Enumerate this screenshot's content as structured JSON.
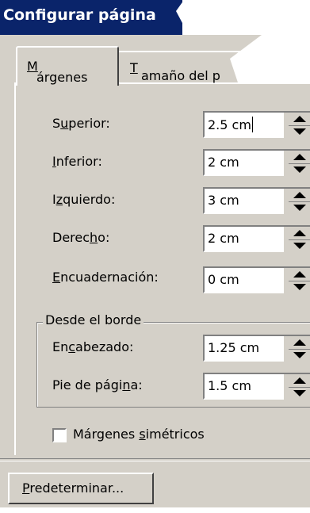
{
  "window": {
    "title": "Configurar página"
  },
  "tabs": [
    {
      "pre": "",
      "u": "M",
      "post": "árgenes"
    },
    {
      "pre": "",
      "u": "T",
      "post": "amaño del p"
    }
  ],
  "margins": [
    {
      "pre": "S",
      "u": "u",
      "post": "perior:",
      "value": "2.5 cm"
    },
    {
      "pre": "",
      "u": "I",
      "post": "nferior:",
      "value": "2 cm"
    },
    {
      "pre": "I",
      "u": "z",
      "post": "quierdo:",
      "value": "3 cm"
    },
    {
      "pre": "Derec",
      "u": "h",
      "post": "o:",
      "value": "2 cm"
    },
    {
      "pre": "",
      "u": "E",
      "post": "ncuadernación:",
      "value": "0 cm"
    }
  ],
  "from_edge": {
    "legend": "Desde el borde",
    "header": {
      "pre": "En",
      "u": "c",
      "post": "abezado:",
      "value": "1.25 cm"
    },
    "footer": {
      "pre": "Pie de pági",
      "u": "n",
      "post": "a:",
      "value": "1.5 cm"
    }
  },
  "mirror_margins": {
    "pre": "Márgenes ",
    "u": "s",
    "post": "imétricos",
    "checked": false
  },
  "default_button": {
    "pre": "",
    "u": "P",
    "post": "redeterminar..."
  }
}
